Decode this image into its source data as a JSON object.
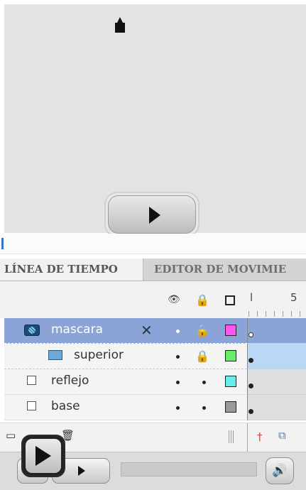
{
  "tabs": {
    "timeline": "LÍNEA DE TIEMPO",
    "motion_editor": "EDITOR DE MOVIMIE"
  },
  "frame_header": {
    "frame_1": "l",
    "frame_5": "5"
  },
  "layers": [
    {
      "name": "mascara",
      "icon": "mask-layer-icon",
      "selected": true,
      "color": "#ff55ee",
      "keyframe": "empty"
    },
    {
      "name": "superior",
      "icon": "masked-layer-icon",
      "selected": false,
      "color": "#66ee66",
      "keyframe": "filled"
    },
    {
      "name": "reflejo",
      "icon": "layer-icon",
      "selected": false,
      "color": "#66eeee",
      "keyframe": "filled"
    },
    {
      "name": "base",
      "icon": "layer-icon",
      "selected": false,
      "color": "#999999",
      "keyframe": "filled"
    }
  ],
  "player": {
    "play_glyph": "►",
    "volume_glyph": "🔊"
  }
}
